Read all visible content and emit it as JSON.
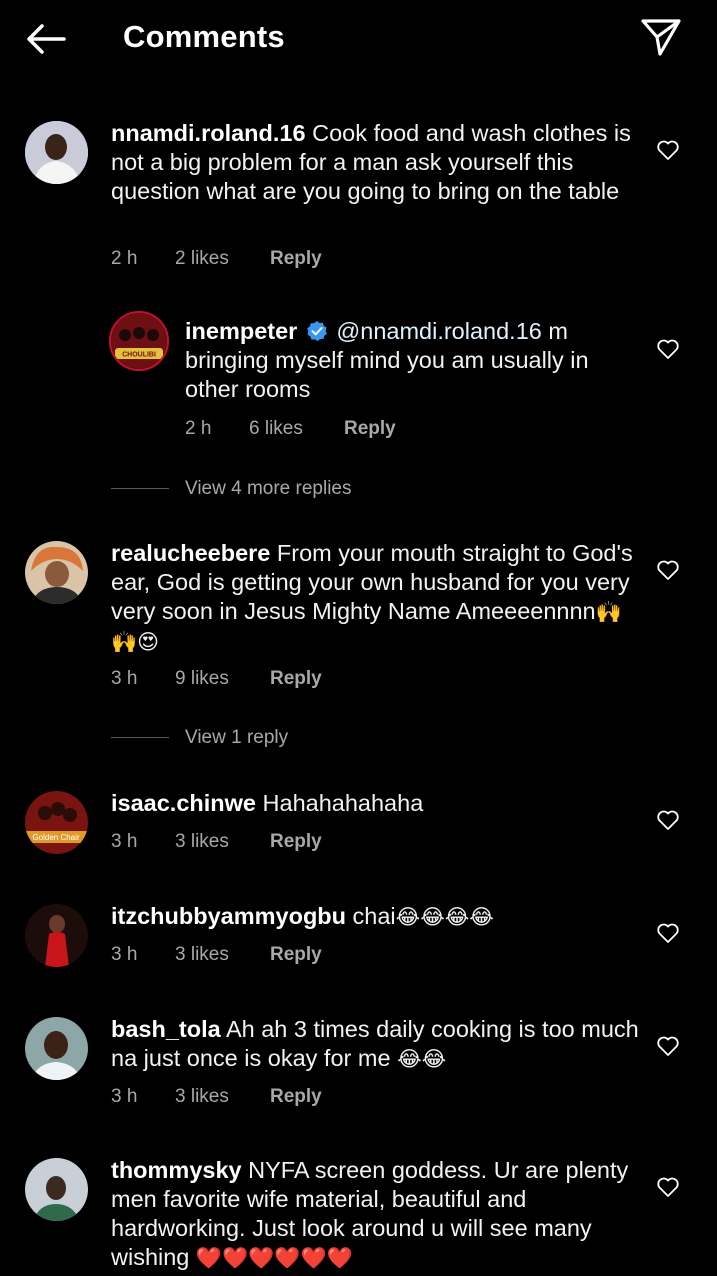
{
  "header": {
    "title": "Comments",
    "back_icon": "arrow-left-icon",
    "send_icon": "paper-plane-icon"
  },
  "comments": [
    {
      "user": "nnamdi.roland.16",
      "text": "Cook food and wash clothes is not a big problem for a man ask yourself this question what are you going to bring on the table",
      "time": "2 h",
      "likes": "2 likes",
      "reply": "Reply"
    },
    {
      "user": "inempeter",
      "mention": "@nnamdi.roland.16",
      "text": "m bringing myself mind you am usually in other rooms",
      "time": "2 h",
      "likes": "6 likes",
      "reply": "Reply",
      "avatar_label": "CHOULIBI"
    },
    {
      "user": "realucheebere",
      "text": "From your mouth straight to God's ear, God is getting your own husband for you very very soon in Jesus Mighty Name Ameeeennnn",
      "emoji": "🙌🙌😍",
      "time": "3 h",
      "likes": "9 likes",
      "reply": "Reply"
    },
    {
      "user": "isaac.chinwe",
      "text": "Hahahahahaha",
      "time": "3 h",
      "likes": "3 likes",
      "reply": "Reply",
      "avatar_label": "Golden Chair"
    },
    {
      "user": "itzchubbyammyogbu",
      "text": "chai",
      "emoji": "😂😂😂😂",
      "time": "3 h",
      "likes": "3 likes",
      "reply": "Reply"
    },
    {
      "user": "bash_tola",
      "text": "Ah ah 3 times daily cooking is too much na just once is okay for me",
      "emoji": "😂😂",
      "time": "3 h",
      "likes": "3 likes",
      "reply": "Reply"
    },
    {
      "user": "thommysky",
      "text": "NYFA screen goddess. Ur are plenty men favorite wife material, beautiful and hardworking. Just look around u will see many wishing",
      "emoji": "❤️❤️❤️❤️❤️❤️"
    }
  ],
  "view_replies": [
    "View 4 more replies",
    "View 1 reply"
  ],
  "colors": {
    "background": "#000000",
    "meta": "#a8a8a8",
    "verified": "#3897f0"
  }
}
